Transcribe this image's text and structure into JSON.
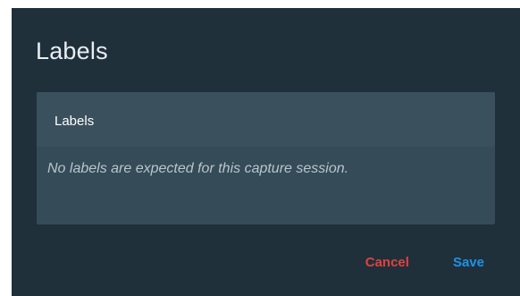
{
  "dialog": {
    "title": "Labels",
    "panel": {
      "header": "Labels",
      "message": "No labels are expected for this capture session."
    },
    "actions": {
      "cancel_label": "Cancel",
      "save_label": "Save"
    }
  },
  "colors": {
    "dialog_background": "#1f303b",
    "panel_background": "#354b58",
    "cancel": "#e0413f",
    "save": "#1e93e6"
  }
}
